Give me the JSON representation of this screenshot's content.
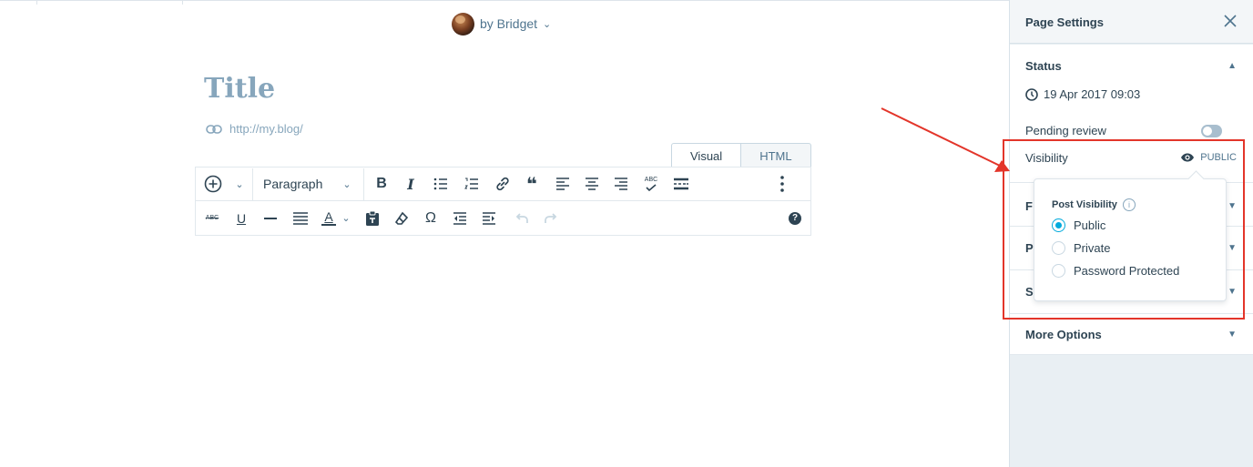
{
  "author": {
    "text": "by Bridget"
  },
  "title": {
    "placeholder": "Title"
  },
  "permalink": {
    "url": "http://my.blog/"
  },
  "editor_tabs": {
    "visual": "Visual",
    "html": "HTML"
  },
  "toolbar": {
    "format_select": "Paragraph",
    "bold": "B",
    "italic": "I",
    "blockquote": "❝",
    "spellcheck": "ABC",
    "strikethrough": "ABC",
    "underline": "U",
    "text_color": "A",
    "special_char": "Ω",
    "help": "?"
  },
  "sidebar": {
    "title": "Page Settings",
    "status": {
      "label": "Status",
      "date": "19 Apr 2017 09:03",
      "pending_label": "Pending review",
      "pending_on": false,
      "visibility_label": "Visibility",
      "visibility_value": "PUBLIC"
    },
    "stubs": [
      "F",
      "P",
      "S"
    ],
    "more_options": "More Options"
  },
  "popover": {
    "heading": "Post Visibility",
    "info": "i",
    "options": [
      {
        "label": "Public",
        "selected": true
      },
      {
        "label": "Private",
        "selected": false
      },
      {
        "label": "Password Protected",
        "selected": false
      }
    ]
  },
  "colors": {
    "accent": "#00aadc",
    "annotation": "#e3352a",
    "sidebar_bg": "#e9eff3"
  }
}
